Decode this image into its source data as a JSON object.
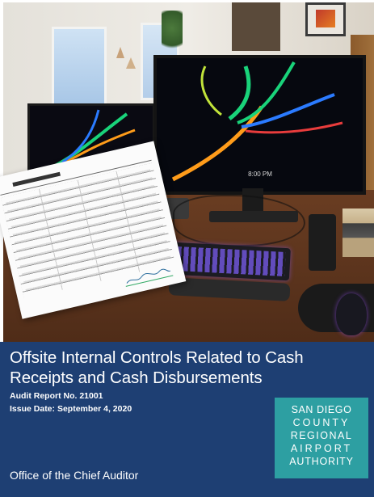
{
  "cover": {
    "title_line1": "Offsite Internal Controls Related to Cash",
    "title_line2": "Receipts and Cash Disbursements",
    "report_number": "Audit Report No. 21001",
    "issue_date": "Issue Date: September 4, 2020",
    "office": "Office of the Chief Auditor"
  },
  "logo": {
    "line1": "SAN DIEGO",
    "line2": "COUNTY",
    "line3": "REGIONAL",
    "line4": "AIRPORT",
    "line5": "AUTHORITY"
  },
  "photo": {
    "monitor_clock": "8:00 PM"
  },
  "colors": {
    "band": "#1e3f73",
    "logo_bg": "#2d9fa2",
    "text": "#ffffff"
  }
}
